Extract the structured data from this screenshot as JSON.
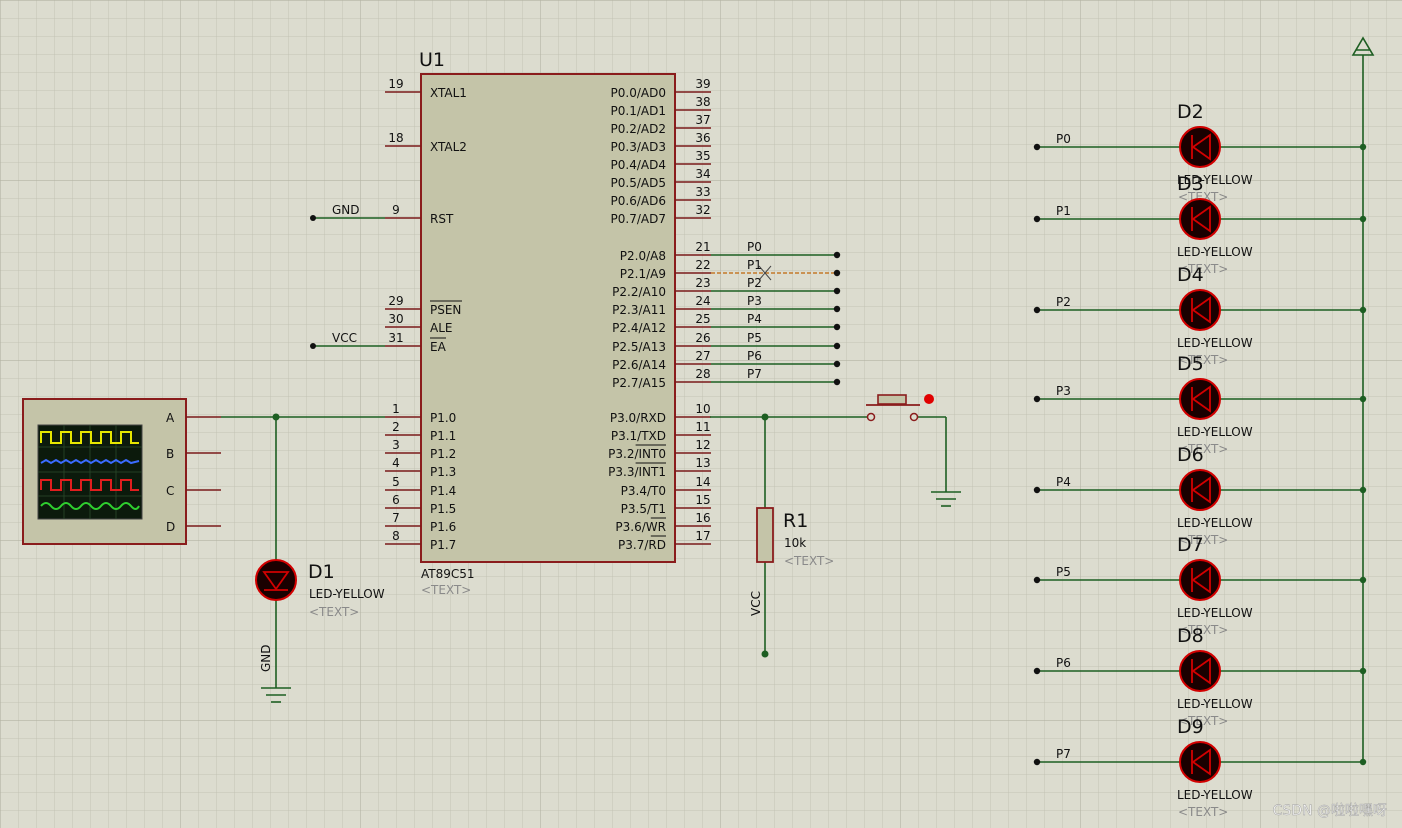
{
  "u1": {
    "ref": "U1",
    "part": "AT89C51",
    "text_hint": "<TEXT>",
    "left_pins": [
      {
        "num": "19",
        "name": "XTAL1",
        "net": ""
      },
      {
        "num": "18",
        "name": "XTAL2",
        "net": ""
      },
      {
        "num": "9",
        "name": "RST",
        "net": "GND"
      },
      {
        "num": "29",
        "name": "PSEN",
        "net": ""
      },
      {
        "num": "30",
        "name": "ALE",
        "net": ""
      },
      {
        "num": "31",
        "name": "EA",
        "net": "VCC"
      },
      {
        "num": "1",
        "name": "P1.0",
        "net": ""
      },
      {
        "num": "2",
        "name": "P1.1",
        "net": ""
      },
      {
        "num": "3",
        "name": "P1.2",
        "net": ""
      },
      {
        "num": "4",
        "name": "P1.3",
        "net": ""
      },
      {
        "num": "5",
        "name": "P1.4",
        "net": ""
      },
      {
        "num": "6",
        "name": "P1.5",
        "net": ""
      },
      {
        "num": "7",
        "name": "P1.6",
        "net": ""
      },
      {
        "num": "8",
        "name": "P1.7",
        "net": ""
      }
    ],
    "right_pins": [
      {
        "num": "39",
        "name": "P0.0/AD0",
        "net": ""
      },
      {
        "num": "38",
        "name": "P0.1/AD1",
        "net": ""
      },
      {
        "num": "37",
        "name": "P0.2/AD2",
        "net": ""
      },
      {
        "num": "36",
        "name": "P0.3/AD3",
        "net": ""
      },
      {
        "num": "35",
        "name": "P0.4/AD4",
        "net": ""
      },
      {
        "num": "34",
        "name": "P0.5/AD5",
        "net": ""
      },
      {
        "num": "33",
        "name": "P0.6/AD6",
        "net": ""
      },
      {
        "num": "32",
        "name": "P0.7/AD7",
        "net": ""
      },
      {
        "num": "21",
        "name": "P2.0/A8",
        "net": "P0"
      },
      {
        "num": "22",
        "name": "P2.1/A9",
        "net": "P1"
      },
      {
        "num": "23",
        "name": "P2.2/A10",
        "net": "P2"
      },
      {
        "num": "24",
        "name": "P2.3/A11",
        "net": "P3"
      },
      {
        "num": "25",
        "name": "P2.4/A12",
        "net": "P4"
      },
      {
        "num": "26",
        "name": "P2.5/A13",
        "net": "P5"
      },
      {
        "num": "27",
        "name": "P2.6/A14",
        "net": "P6"
      },
      {
        "num": "28",
        "name": "P2.7/A15",
        "net": "P7"
      },
      {
        "num": "10",
        "name": "P3.0/RXD",
        "net": ""
      },
      {
        "num": "11",
        "name": "P3.1/TXD",
        "net": ""
      },
      {
        "num": "12",
        "name": "P3.2/INT0",
        "net": ""
      },
      {
        "num": "13",
        "name": "P3.3/INT1",
        "net": ""
      },
      {
        "num": "14",
        "name": "P3.4/T0",
        "net": ""
      },
      {
        "num": "15",
        "name": "P3.5/T1",
        "net": ""
      },
      {
        "num": "16",
        "name": "P3.6/WR",
        "net": ""
      },
      {
        "num": "17",
        "name": "P3.7/RD",
        "net": ""
      }
    ]
  },
  "scope": {
    "channels": [
      "A",
      "B",
      "C",
      "D"
    ]
  },
  "d1": {
    "ref": "D1",
    "part": "LED-YELLOW",
    "text_hint": "<TEXT>",
    "gnd": "GND"
  },
  "r1": {
    "ref": "R1",
    "value": "10k",
    "text_hint": "<TEXT>",
    "vcc": "VCC"
  },
  "leds": [
    {
      "ref": "D2",
      "part": "LED-YELLOW",
      "text_hint": "<TEXT>",
      "net": "P0"
    },
    {
      "ref": "D3",
      "part": "LED-YELLOW",
      "text_hint": "<TEXT>",
      "net": "P1"
    },
    {
      "ref": "D4",
      "part": "LED-YELLOW",
      "text_hint": "<TEXT>",
      "net": "P2"
    },
    {
      "ref": "D5",
      "part": "LED-YELLOW",
      "text_hint": "<TEXT>",
      "net": "P3"
    },
    {
      "ref": "D6",
      "part": "LED-YELLOW",
      "text_hint": "<TEXT>",
      "net": "P4"
    },
    {
      "ref": "D7",
      "part": "LED-YELLOW",
      "text_hint": "<TEXT>",
      "net": "P5"
    },
    {
      "ref": "D8",
      "part": "LED-YELLOW",
      "text_hint": "<TEXT>",
      "net": "P6"
    },
    {
      "ref": "D9",
      "part": "LED-YELLOW",
      "text_hint": "<TEXT>",
      "net": "P7"
    }
  ],
  "watermark": "CSDN @啦啦嘿呀",
  "colors": {
    "background": "#dcdccf",
    "chip_body": "#c4c4a8",
    "chip_border": "#8a1c1c",
    "wire": "#1d5e22",
    "led_body": "#1a0000",
    "led_glow": "#d20000"
  }
}
